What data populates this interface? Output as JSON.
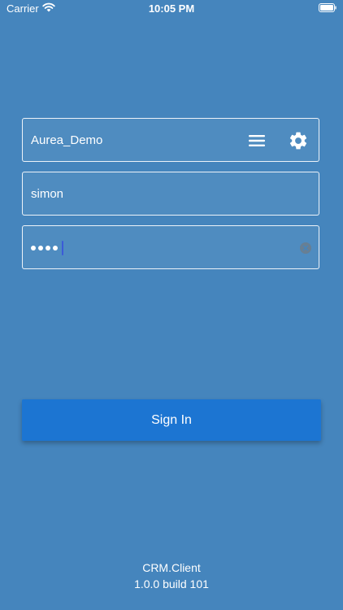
{
  "status_bar": {
    "carrier": "Carrier",
    "time": "10:05 PM",
    "wifi_icon": "wifi-icon",
    "battery_icon": "battery-icon"
  },
  "login": {
    "server": {
      "value": "Aurea_Demo",
      "menu_icon": "menu-icon",
      "settings_icon": "gear-icon"
    },
    "username": {
      "value": "simon"
    },
    "password": {
      "masked_length": 4,
      "clear_icon": "clear-icon"
    },
    "sign_in_label": "Sign In"
  },
  "footer": {
    "app_name": "CRM.Client",
    "version": "1.0.0 build 101"
  },
  "colors": {
    "background": "#4585bd",
    "button": "#1c75d2",
    "text": "#ffffff"
  }
}
